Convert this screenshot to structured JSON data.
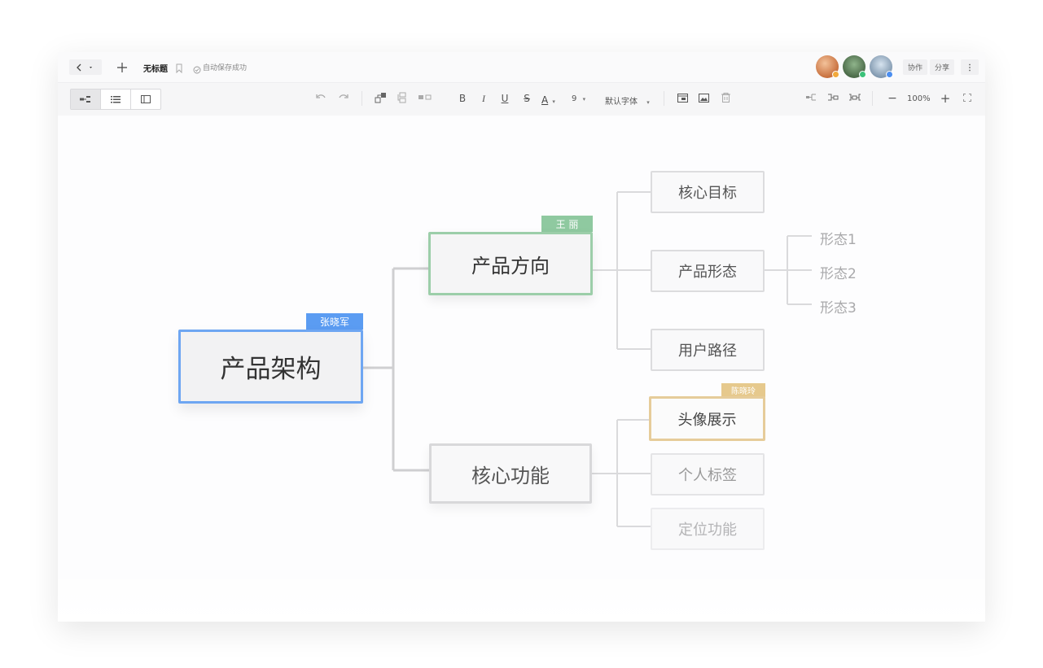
{
  "topbar": {
    "back_icon": "chevron-left-icon",
    "dropdown_icon": "caret-down-icon",
    "new_icon": "plus-icon",
    "title": "无标题",
    "bookmark_icon": "bookmark-icon",
    "status_icon": "check-circle-icon",
    "save_status": "自动保存成功",
    "collaborate_label": "协作",
    "share_label": "分享",
    "more_icon": "more-vertical-icon",
    "avatars": [
      {
        "name": "user-avatar-1",
        "status_color": "#f2a93b"
      },
      {
        "name": "user-avatar-2",
        "status_color": "#3cc27a"
      },
      {
        "name": "user-avatar-3",
        "status_color": "#4b8ef0"
      }
    ]
  },
  "toolbar": {
    "view_modes": [
      "mindmap-view-icon",
      "outline-view-icon",
      "panel-view-icon"
    ],
    "undo_icon": "undo-icon",
    "redo_icon": "redo-icon",
    "add_child_icon": "add-child-node-icon",
    "add_sibling_icon": "add-sibling-node-icon",
    "add_parent_icon": "add-parent-node-icon",
    "bold": "B",
    "italic": "I",
    "underline": "U",
    "strike": "S",
    "font_color": "A",
    "font_size": "9",
    "font_family": "默认字体",
    "insert_card_icon": "card-icon",
    "insert_image_icon": "image-icon",
    "delete_icon": "trash-icon",
    "layout_icons": [
      "layout-left-icon",
      "layout-right-icon",
      "layout-center-icon"
    ],
    "zoom_out": "−",
    "zoom_level": "100%",
    "zoom_in": "+",
    "fullscreen_icon": "fullscreen-icon"
  },
  "mindmap": {
    "root": {
      "label": "产品架构",
      "tag": "张晓军",
      "color": "#5b9cf2"
    },
    "branches": [
      {
        "label": "产品方向",
        "tag": "王 丽",
        "color": "#8fc9a0",
        "children": [
          {
            "label": "核心目标"
          },
          {
            "label": "产品形态",
            "children": [
              "形态1",
              "形态2",
              "形态3"
            ]
          },
          {
            "label": "用户路径"
          }
        ]
      },
      {
        "label": "核心功能",
        "children": [
          {
            "label": "头像展示",
            "tag": "陈晓玲",
            "color": "#e6c98d"
          },
          {
            "label": "个人标签"
          },
          {
            "label": "定位功能"
          }
        ]
      }
    ]
  }
}
